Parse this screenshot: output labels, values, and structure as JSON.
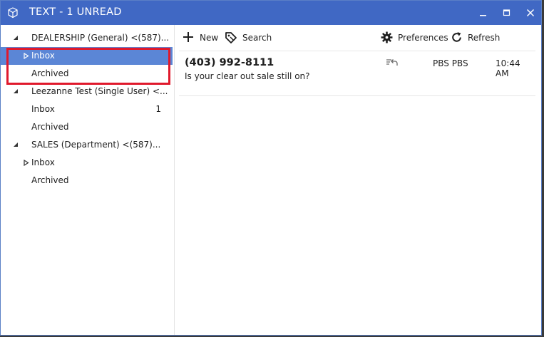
{
  "window": {
    "title": "TEXT - 1 UNREAD"
  },
  "sidebar": {
    "groups": [
      {
        "name": "DEALERSHIP (General)  <(587)...",
        "items": [
          {
            "label": "Inbox",
            "count": "",
            "selected": true
          },
          {
            "label": "Archived",
            "count": ""
          }
        ]
      },
      {
        "name": "Leezanne Test (Single User) <...",
        "items": [
          {
            "label": "Inbox",
            "count": "1"
          },
          {
            "label": "Archived",
            "count": ""
          }
        ]
      },
      {
        "name": "SALES (Department)  <(587)...",
        "items": [
          {
            "label": "Inbox",
            "count": ""
          },
          {
            "label": "Archived",
            "count": ""
          }
        ]
      }
    ]
  },
  "toolbar": {
    "new_label": "New",
    "search_label": "Search",
    "preferences_label": "Preferences",
    "refresh_label": "Refresh"
  },
  "messages": [
    {
      "phone": "(403) 992-8111",
      "preview": "Is your clear out sale still on?",
      "sender": "PBS PBS",
      "time": "10:44 AM"
    }
  ],
  "colors": {
    "titlebar": "#4068c4",
    "selected_row": "#5b86d6",
    "annotation_box": "#e0192c"
  }
}
